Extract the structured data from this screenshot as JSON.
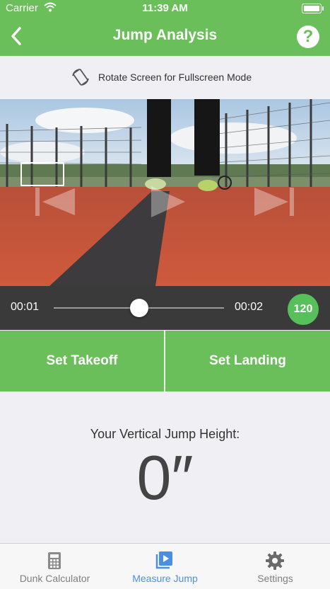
{
  "status_bar": {
    "carrier": "Carrier",
    "time": "11:39 AM"
  },
  "nav": {
    "title": "Jump Analysis",
    "back_icon": "chevron-left-icon",
    "help_label": "?"
  },
  "rotate_hint": {
    "text": "Rotate Screen for Fullscreen Mode",
    "icon": "rotate-icon"
  },
  "player": {
    "current_time": "00:01",
    "end_time": "00:02",
    "fps": "120",
    "progress": 0.5
  },
  "actions": {
    "takeoff_label": "Set Takeoff",
    "landing_label": "Set Landing"
  },
  "result": {
    "label": "Your Vertical Jump Height:",
    "value": "0″"
  },
  "tabs": [
    {
      "label": "Dunk Calculator",
      "icon": "calculator-icon"
    },
    {
      "label": "Measure Jump",
      "icon": "play-square-icon",
      "active": true
    },
    {
      "label": "Settings",
      "icon": "gear-icon"
    }
  ],
  "colors": {
    "accent": "#6abf5a",
    "fps_badge": "#58c05a",
    "active_tab": "#4a90e2"
  }
}
